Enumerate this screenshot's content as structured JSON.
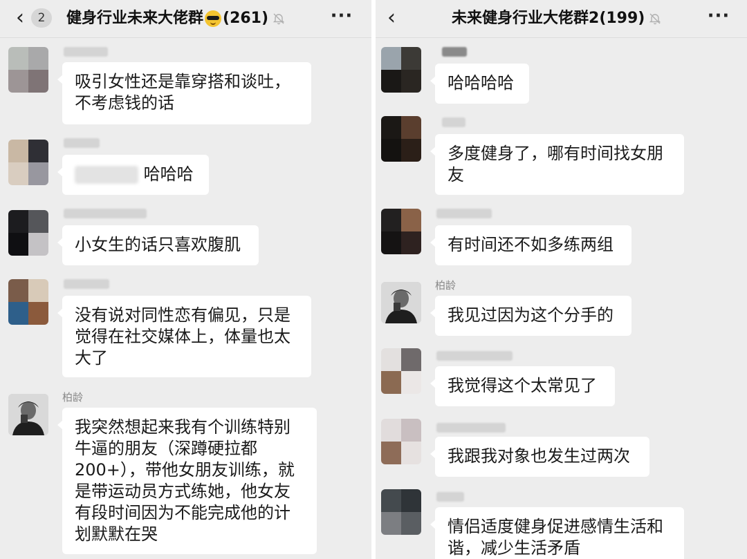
{
  "left": {
    "header": {
      "back_glyph": "‹",
      "unread": "2",
      "title": "健身行业未来大佬群",
      "emoji": "sunglasses-face",
      "count": "(261)",
      "more": "···"
    },
    "messages": [
      {
        "sender": "",
        "text": "吸引女性还是靠穿搭和谈吐，不考虑钱的话"
      },
      {
        "sender": "",
        "text": "哈哈哈"
      },
      {
        "sender": "",
        "text": "小女生的话只喜欢腹肌"
      },
      {
        "sender": "",
        "text": "没有说对同性恋有偏见，只是觉得在社交媒体上，体量也太大了"
      },
      {
        "sender": "柏龄",
        "text": "我突然想起来我有个训练特别牛逼的朋友（深蹲硬拉都200+），带他女朋友训练，就是带运动员方式练她，他女友有段时间因为不能完成他的计划默默在哭"
      }
    ]
  },
  "right": {
    "header": {
      "back_glyph": "‹",
      "title": "未来健身行业大佬群2",
      "count": "(199)",
      "more": "···"
    },
    "messages": [
      {
        "sender": "",
        "text": "哈哈哈哈"
      },
      {
        "sender": "",
        "text": "多度健身了，哪有时间找女朋友"
      },
      {
        "sender": "",
        "text": "有时间还不如多练两组"
      },
      {
        "sender": "柏龄",
        "text": "我见过因为这个分手的"
      },
      {
        "sender": "",
        "text": "我觉得这个太常见了"
      },
      {
        "sender": "",
        "text": "我跟我对象也发生过两次"
      },
      {
        "sender": "",
        "text": "情侣适度健身促进感情生活和谐，减少生活矛盾"
      }
    ]
  },
  "colors": {
    "background": "#ededed",
    "bubble": "#ffffff",
    "sender": "#8a8a8a",
    "text": "#1a1a1a"
  }
}
